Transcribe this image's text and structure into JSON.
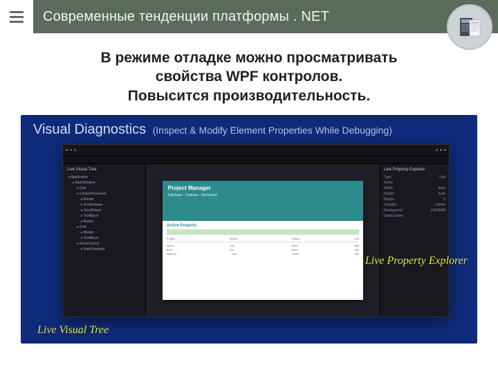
{
  "header": {
    "title": "Современные тенденции платформы . NET"
  },
  "subtitle": {
    "line1": "В режиме отладке можно просматривать",
    "line2": "свойства WPF контролов.",
    "line3": "Повысится производительность."
  },
  "figure": {
    "main_title": "Visual Diagnostics",
    "sub_title": "(Inspect & Modify Element Properties While Debugging)",
    "callout_left": "Live Visual Tree",
    "callout_right": "Live Property Explorer",
    "left_panel": {
      "title": "Live Visual Tree",
      "nodes": [
        "Application",
        "MainWindow",
        "Grid",
        "ContentPresenter",
        "Border",
        "ScrollViewer",
        "StackPanel",
        "TextBlock",
        "Button",
        "Grid",
        "Border",
        "TextBlock",
        "ItemsControl",
        "DataTemplate"
      ]
    },
    "right_panel": {
      "title": "Live Property Explorer",
      "props": [
        {
          "k": "Type",
          "v": "Grid"
        },
        {
          "k": "Name",
          "v": ""
        },
        {
          "k": "Width",
          "v": "Auto"
        },
        {
          "k": "Height",
          "v": "Auto"
        },
        {
          "k": "Margin",
          "v": "0"
        },
        {
          "k": "Visibility",
          "v": "Visible"
        },
        {
          "k": "Background",
          "v": "#2E8B8B"
        },
        {
          "k": "DataContext",
          "v": "…"
        }
      ]
    },
    "app": {
      "hero_title": "Project Manager",
      "hero_sub": "Fabrikam · Contoso · Northwind",
      "section_title": "Active Projects",
      "rows": [
        {
          "a": "Project",
          "b": "Owner",
          "c": "Status",
          "d": "Due"
        },
        {
          "a": "Alpha",
          "b": "Kim",
          "c": "Open",
          "d": "Mar"
        },
        {
          "a": "Beta",
          "b": "Lee",
          "c": "Open",
          "d": "Apr"
        },
        {
          "a": "Gamma",
          "b": "Ana",
          "c": "Done",
          "d": "Feb"
        }
      ]
    }
  }
}
